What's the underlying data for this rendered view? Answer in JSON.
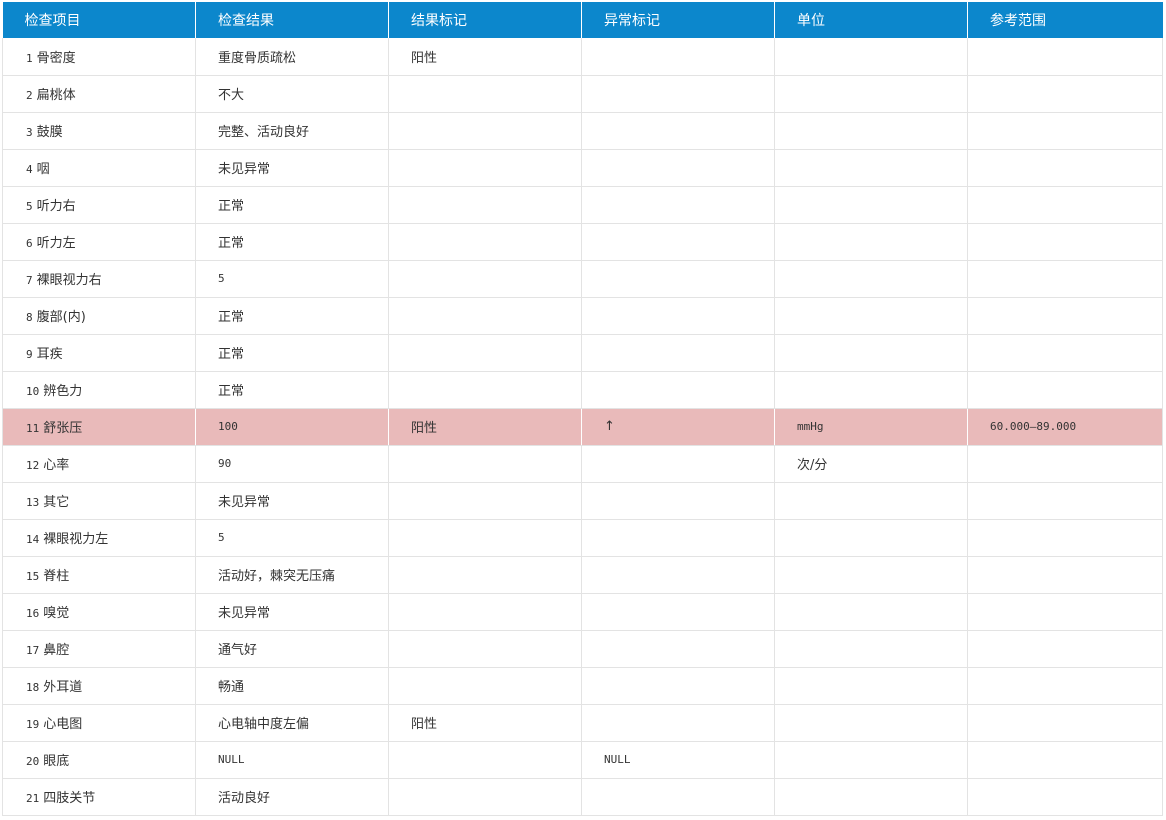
{
  "table": {
    "columns": [
      "检查项目",
      "检查结果",
      "结果标记",
      "异常标记",
      "单位",
      "参考范围"
    ],
    "rows": [
      {
        "no": "1",
        "item": "骨密度",
        "result": "重度骨质疏松",
        "flag": "阳性",
        "abn": "",
        "unit": "",
        "range": ""
      },
      {
        "no": "2",
        "item": "扁桃体",
        "result": "不大",
        "flag": "",
        "abn": "",
        "unit": "",
        "range": ""
      },
      {
        "no": "3",
        "item": "鼓膜",
        "result": "完整、活动良好",
        "flag": "",
        "abn": "",
        "unit": "",
        "range": ""
      },
      {
        "no": "4",
        "item": "咽",
        "result": "未见异常",
        "flag": "",
        "abn": "",
        "unit": "",
        "range": ""
      },
      {
        "no": "5",
        "item": "听力右",
        "result": "正常",
        "flag": "",
        "abn": "",
        "unit": "",
        "range": ""
      },
      {
        "no": "6",
        "item": "听力左",
        "result": "正常",
        "flag": "",
        "abn": "",
        "unit": "",
        "range": ""
      },
      {
        "no": "7",
        "item": "裸眼视力右",
        "result": "5",
        "flag": "",
        "abn": "",
        "unit": "",
        "range": ""
      },
      {
        "no": "8",
        "item": "腹部(内)",
        "result": "正常",
        "flag": "",
        "abn": "",
        "unit": "",
        "range": ""
      },
      {
        "no": "9",
        "item": "耳疾",
        "result": "正常",
        "flag": "",
        "abn": "",
        "unit": "",
        "range": ""
      },
      {
        "no": "10",
        "item": "辨色力",
        "result": "正常",
        "flag": "",
        "abn": "",
        "unit": "",
        "range": ""
      },
      {
        "no": "11",
        "item": "舒张压",
        "result": "100",
        "flag": "阳性",
        "abn": "↑",
        "unit": "mmHg",
        "range": "60.000—89.000",
        "highlight": true
      },
      {
        "no": "12",
        "item": "心率",
        "result": "90",
        "flag": "",
        "abn": "",
        "unit": "次/分",
        "range": ""
      },
      {
        "no": "13",
        "item": "其它",
        "result": "未见异常",
        "flag": "",
        "abn": "",
        "unit": "",
        "range": ""
      },
      {
        "no": "14",
        "item": "裸眼视力左",
        "result": "5",
        "flag": "",
        "abn": "",
        "unit": "",
        "range": ""
      },
      {
        "no": "15",
        "item": "脊柱",
        "result": "活动好，棘突无压痛",
        "flag": "",
        "abn": "",
        "unit": "",
        "range": ""
      },
      {
        "no": "16",
        "item": "嗅觉",
        "result": "未见异常",
        "flag": "",
        "abn": "",
        "unit": "",
        "range": ""
      },
      {
        "no": "17",
        "item": "鼻腔",
        "result": "通气好",
        "flag": "",
        "abn": "",
        "unit": "",
        "range": ""
      },
      {
        "no": "18",
        "item": "外耳道",
        "result": "畅通",
        "flag": "",
        "abn": "",
        "unit": "",
        "range": ""
      },
      {
        "no": "19",
        "item": "心电图",
        "result": "心电轴中度左偏",
        "flag": "阳性",
        "abn": "",
        "unit": "",
        "range": ""
      },
      {
        "no": "20",
        "item": "眼底",
        "result": "NULL",
        "flag": "",
        "abn": "NULL",
        "unit": "",
        "range": ""
      },
      {
        "no": "21",
        "item": "四肢关节",
        "result": "活动良好",
        "flag": "",
        "abn": "",
        "unit": "",
        "range": ""
      }
    ]
  },
  "colors": {
    "header_bg": "#0c87cc",
    "highlight_row_bg": "#e9baba"
  }
}
